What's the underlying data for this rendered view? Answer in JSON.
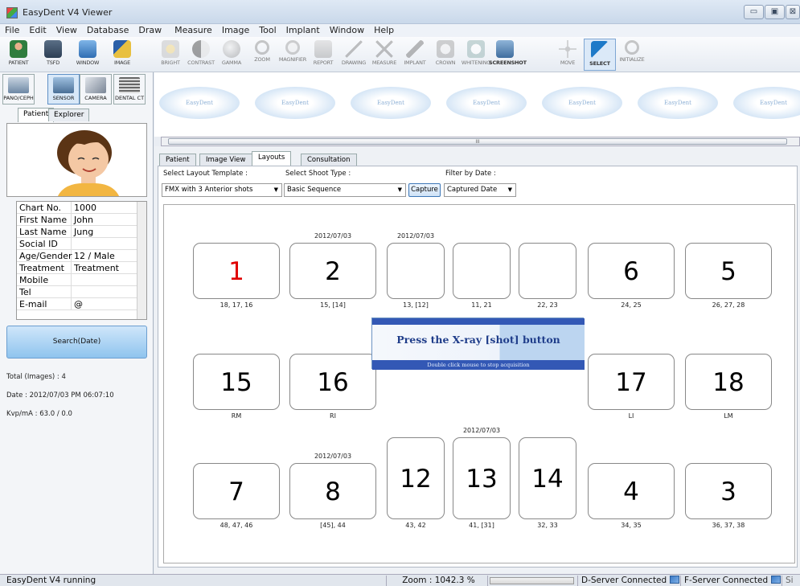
{
  "window": {
    "title": "EasyDent V4 Viewer",
    "min": "▭",
    "max": "▣",
    "close": "⊠"
  },
  "menu": [
    "File",
    "Edit",
    "View",
    "Database",
    "Draw",
    "Measure",
    "Image",
    "Tool",
    "Implant",
    "Window",
    "Help"
  ],
  "toolbar": {
    "left": [
      "PATIENT",
      "TSFD",
      "WINDOW",
      "IMAGE"
    ],
    "tools": [
      "BRIGHT",
      "CONTRAST",
      "GAMMA",
      "ZOOM",
      "MAGNIFIER",
      "REPORT",
      "DRAWING",
      "MEASURE",
      "IMPLANT",
      "CROWN",
      "WHITENING",
      "SCREENSHOT",
      "MOVE",
      "SELECT",
      "INITIALIZE"
    ],
    "active": "SELECT"
  },
  "sources": [
    "PANO/CEPH",
    "SENSOR",
    "CAMERA",
    "DENTAL CT"
  ],
  "active_source": "SENSOR",
  "patient_tabs": [
    "Patient",
    "Explorer"
  ],
  "patient_info": [
    {
      "k": "Chart No.",
      "v": "1000"
    },
    {
      "k": "First Name",
      "v": "John"
    },
    {
      "k": "Last Name",
      "v": "Jung"
    },
    {
      "k": "Social ID",
      "v": ""
    },
    {
      "k": "Age/Gender",
      "v": "12 / Male"
    },
    {
      "k": "Treatment",
      "v": "Treatment"
    },
    {
      "k": "Mobile",
      "v": ""
    },
    {
      "k": "Tel",
      "v": ""
    },
    {
      "k": "E-mail",
      "v": "@"
    }
  ],
  "search_label": "Search(Date)",
  "stats": {
    "total": "Total (Images) : 4",
    "date": "Date : 2012/07/03 PM 06:07:10",
    "kvp": "Kvp/mA : 63.0 / 0.0"
  },
  "thumb_label": "EasyDent",
  "scroll_grip": "III",
  "content_tabs": [
    "Patient",
    "Image View",
    "Layouts",
    "Consultation"
  ],
  "active_content_tab": "Layouts",
  "filters": {
    "layout_label": "Select Layout Template :",
    "layout_value": "FMX with 3 Anterior shots",
    "shoot_label": "Select Shoot Type :",
    "shoot_value": "Basic Sequence",
    "capture": "Capture",
    "date_label": "Filter by Date :",
    "date_value": "Captured Date"
  },
  "shots": [
    {
      "num": "1",
      "caption": "18, 17, 16",
      "date": "",
      "current": true
    },
    {
      "num": "2",
      "caption": "15, [14]",
      "date": "2012/07/03",
      "current": false
    },
    {
      "num": "",
      "caption": "13, [12]",
      "date": "2012/07/03",
      "current": false
    },
    {
      "num": "",
      "caption": "11, 21",
      "date": "",
      "current": false
    },
    {
      "num": "",
      "caption": "22, 23",
      "date": "",
      "current": false
    },
    {
      "num": "6",
      "caption": "24, 25",
      "date": "",
      "current": false
    },
    {
      "num": "5",
      "caption": "26, 27, 28",
      "date": "",
      "current": false
    },
    {
      "num": "15",
      "caption": "RM",
      "date": "",
      "current": false
    },
    {
      "num": "16",
      "caption": "RI",
      "date": "",
      "current": false
    },
    {
      "num": "17",
      "caption": "LI",
      "date": "",
      "current": false
    },
    {
      "num": "18",
      "caption": "LM",
      "date": "",
      "current": false
    },
    {
      "num": "7",
      "caption": "48, 47, 46",
      "date": "",
      "current": false
    },
    {
      "num": "8",
      "caption": "[45], 44",
      "date": "2012/07/03",
      "current": false
    },
    {
      "num": "12",
      "caption": "43, 42",
      "date": "",
      "current": false
    },
    {
      "num": "13",
      "caption": "41, [31]",
      "date": "2012/07/03",
      "current": false
    },
    {
      "num": "14",
      "caption": "32, 33",
      "date": "",
      "current": false
    },
    {
      "num": "4",
      "caption": "34, 35",
      "date": "",
      "current": false
    },
    {
      "num": "3",
      "caption": "36, 37, 38",
      "date": "",
      "current": false
    }
  ],
  "popup": {
    "message": "Press the X-ray [shot] button",
    "hint": "Double click mouse to stop acquisition"
  },
  "status": {
    "app": "EasyDent V4 running",
    "zoom": "Zoom : 1042.3 %",
    "dserver": "D-Server Connected",
    "fserver": "F-Server Connected",
    "extra": "Si"
  }
}
